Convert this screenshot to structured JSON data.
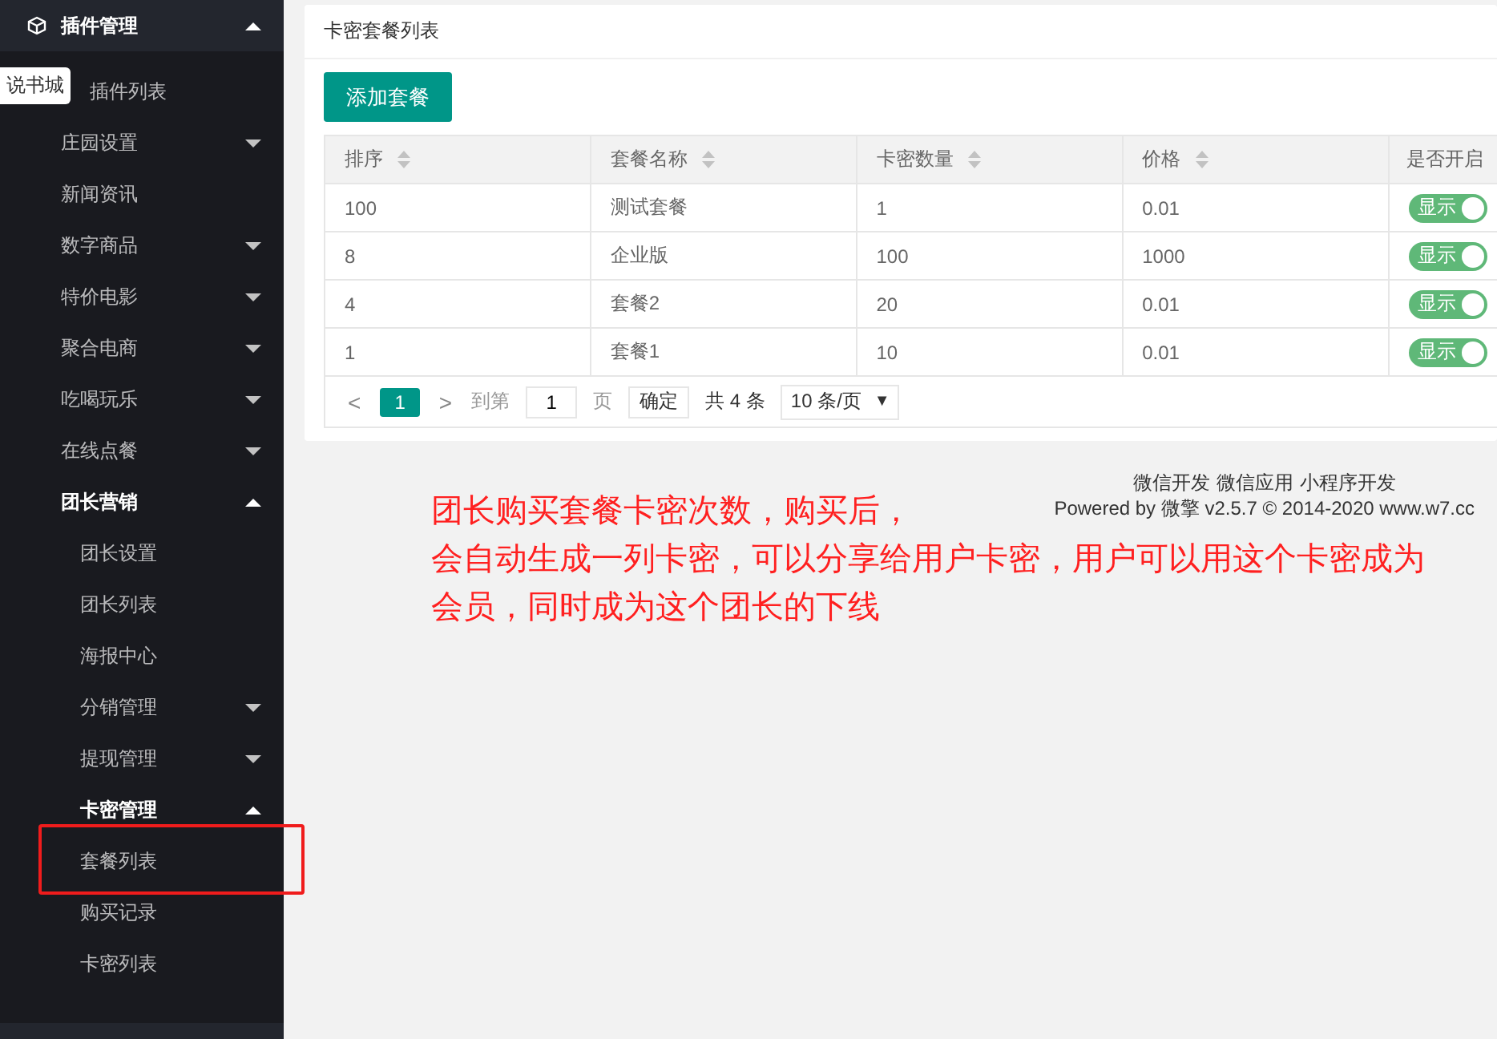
{
  "sidebar": {
    "menu": {
      "label": "插件管理",
      "expanded": true,
      "children": [
        {
          "label": "插件列表"
        },
        {
          "label": "庄园设置",
          "expanded": false
        },
        {
          "label": "新闻资讯"
        },
        {
          "label": "数字商品",
          "expanded": false
        },
        {
          "label": "特价电影",
          "expanded": false
        },
        {
          "label": "聚合电商",
          "expanded": false
        },
        {
          "label": "吃喝玩乐",
          "expanded": false
        },
        {
          "label": "在线点餐",
          "expanded": false
        },
        {
          "label": "团长营销",
          "expanded": true,
          "children": [
            {
              "label": "团长设置"
            },
            {
              "label": "团长列表"
            },
            {
              "label": "海报中心"
            },
            {
              "label": "分销管理",
              "expanded": false
            },
            {
              "label": "提现管理",
              "expanded": false
            },
            {
              "label": "卡密管理",
              "expanded": true,
              "children": [
                {
                  "label": "套餐列表",
                  "highlighted": true
                },
                {
                  "label": "购买记录"
                },
                {
                  "label": "卡密列表"
                }
              ]
            }
          ]
        }
      ]
    },
    "tooltip": "说书城"
  },
  "card": {
    "title": "卡密套餐列表",
    "add_button": "添加套餐",
    "table": {
      "columns": [
        {
          "label": "排序",
          "sortable": true
        },
        {
          "label": "套餐名称",
          "sortable": true
        },
        {
          "label": "卡密数量",
          "sortable": true
        },
        {
          "label": "价格",
          "sortable": true
        },
        {
          "label": "是否开启"
        }
      ],
      "rows": [
        {
          "cells": [
            "100",
            "测试套餐",
            "1",
            "0.01"
          ],
          "toggle": {
            "label": "显示",
            "on": true
          }
        },
        {
          "cells": [
            "8",
            "企业版",
            "100",
            "1000"
          ],
          "toggle": {
            "label": "显示",
            "on": true
          }
        },
        {
          "cells": [
            "4",
            "套餐2",
            "20",
            "0.01"
          ],
          "toggle": {
            "label": "显示",
            "on": true
          }
        },
        {
          "cells": [
            "1",
            "套餐1",
            "10",
            "0.01"
          ],
          "toggle": {
            "label": "显示",
            "on": true
          }
        }
      ]
    },
    "pagination": {
      "prev": "<",
      "pages": [
        {
          "label": "1",
          "selected": true
        }
      ],
      "next": ">",
      "goto_label": "到第",
      "goto_value": "1",
      "page_label": "页",
      "confirm": "确定",
      "total": "共 4 条",
      "page_size": "10 条/页",
      "caret": "▼"
    }
  },
  "footer": {
    "links": [
      "微信开发",
      "微信应用",
      "小程序开发"
    ],
    "powered": "Powered by 微擎 v2.5.7 © 2014-2020 www.w7.cc"
  },
  "annotation": {
    "lines": [
      "团长购买套餐卡密次数，购买后，",
      "会自动生成一列卡密，可以分享给用户卡密，用户可以用这个卡密成为会员，同时成为这个团长的下线"
    ]
  }
}
